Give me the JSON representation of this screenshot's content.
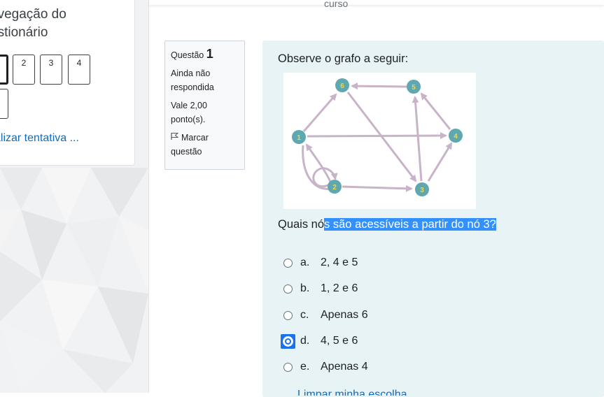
{
  "sidebar": {
    "title": "avegação do\nestionário",
    "buttons": [
      "",
      "2",
      "3",
      "4",
      ""
    ],
    "finish_label": "alizar tentativa ..."
  },
  "header": {
    "course_label": "curso"
  },
  "info": {
    "question_label": "Questão",
    "question_number": "1",
    "status": "Ainda não respondida",
    "grade": "Vale 2,00 ponto(s).",
    "flag_label": "Marcar questão"
  },
  "question": {
    "prompt": "Observe o grafo a seguir:",
    "text_unselected": "Quais nó",
    "text_selected": "s são acessíveis a partir do nó 3?",
    "selected_option": "d",
    "options": [
      {
        "letter": "a.",
        "text": "2, 4 e 5"
      },
      {
        "letter": "b.",
        "text": "1, 2 e 6"
      },
      {
        "letter": "c.",
        "text": "Apenas 6"
      },
      {
        "letter": "d.",
        "text": "4, 5 e 6"
      },
      {
        "letter": "e.",
        "text": "Apenas 4"
      }
    ],
    "partial_link": "Limpar minha escolha"
  },
  "graph": {
    "node_color": "#5fa8b0",
    "label_color": "#f2d64b",
    "edge_color": "#c8b4c8",
    "nodes": [
      "1",
      "2",
      "3",
      "4",
      "5",
      "6"
    ]
  },
  "colors": {
    "panel": "#e7f3f5",
    "selection": "#3390ff",
    "link": "#0f6cbf"
  }
}
